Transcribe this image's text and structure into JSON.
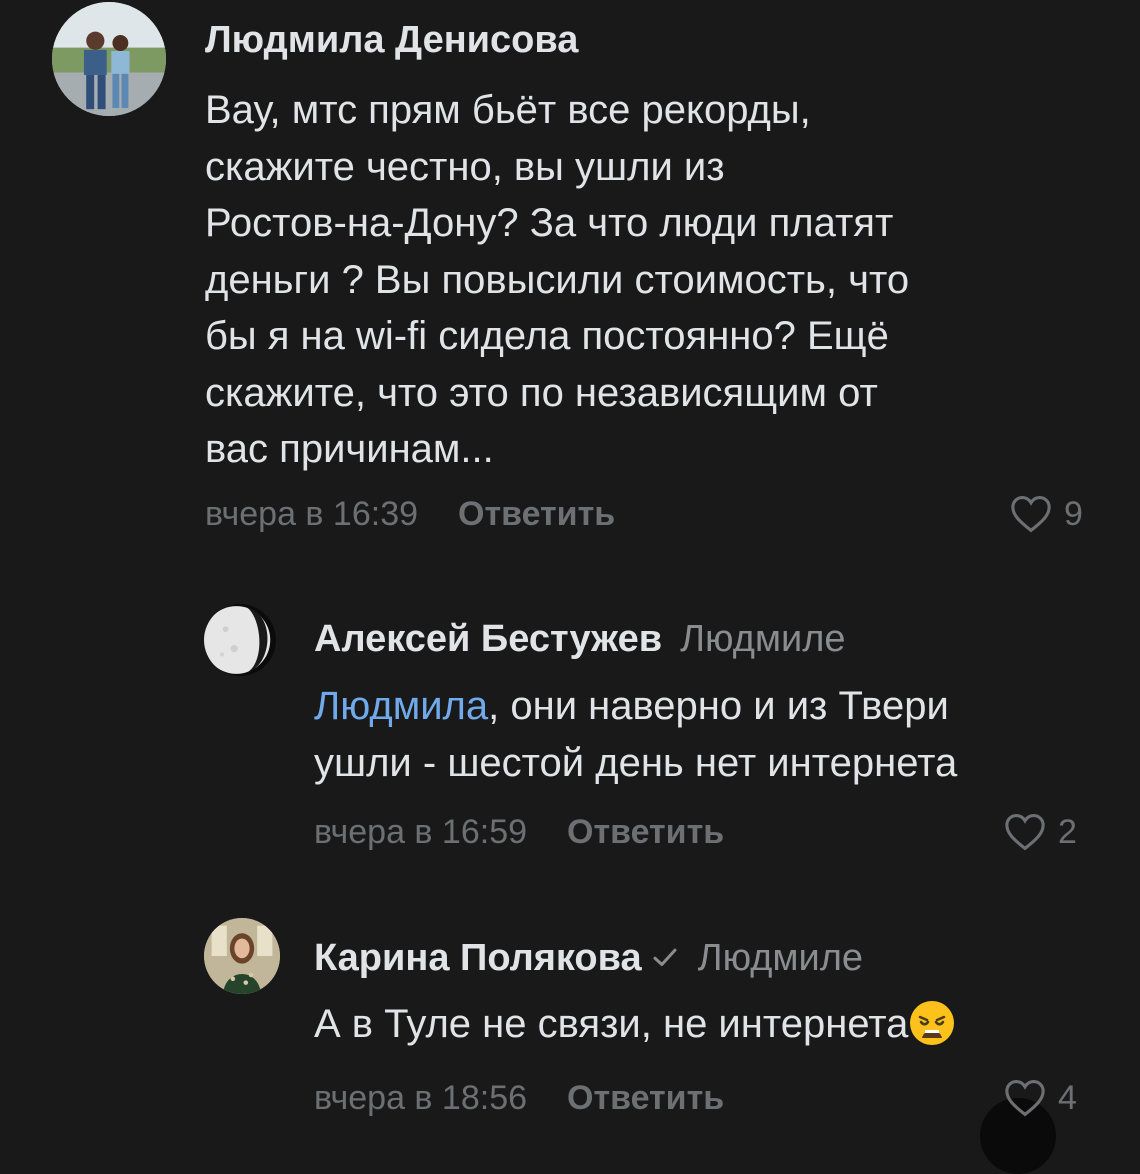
{
  "comments": [
    {
      "author": "Людмила Денисова",
      "reply_to": "",
      "text_lines": [
        "Вау, мтс прям бьёт все рекорды,",
        "скажите честно, вы ушли из",
        "Ростов-на-Дону? За что люди платят",
        "деньги ? Вы повысили стоимость, что",
        "бы я на wi-fi сидела постоянно? Ещё",
        "скажите, что это по независящим от",
        "вас причинам..."
      ],
      "time": "вчера в 16:39",
      "reply_label": "Ответить",
      "likes": "9",
      "avatar_icon": "photo-avatar"
    },
    {
      "author": "Алексей Бестужев",
      "reply_to": "Людмиле",
      "mention": "Людмила",
      "text_line1_rest": ", они наверно и из Твери",
      "text_line2": "ушли - шестой день нет интернета",
      "time": "вчера в 16:59",
      "reply_label": "Ответить",
      "likes": "2",
      "avatar_icon": "moon-avatar"
    },
    {
      "author": "Карина Полякова",
      "reply_to": "Людмиле",
      "verified_icon": "verified-check-icon",
      "text": "А в Туле не связи, не интернета",
      "emoji_icon": "weary-face-emoji",
      "time": "вчера в 18:56",
      "reply_label": "Ответить",
      "likes": "4",
      "avatar_icon": "photo-avatar"
    }
  ],
  "colors": {
    "background": "#19191a",
    "text": "#e1e3e6",
    "secondary": "#6d6f73",
    "mention": "#71aaeb"
  }
}
